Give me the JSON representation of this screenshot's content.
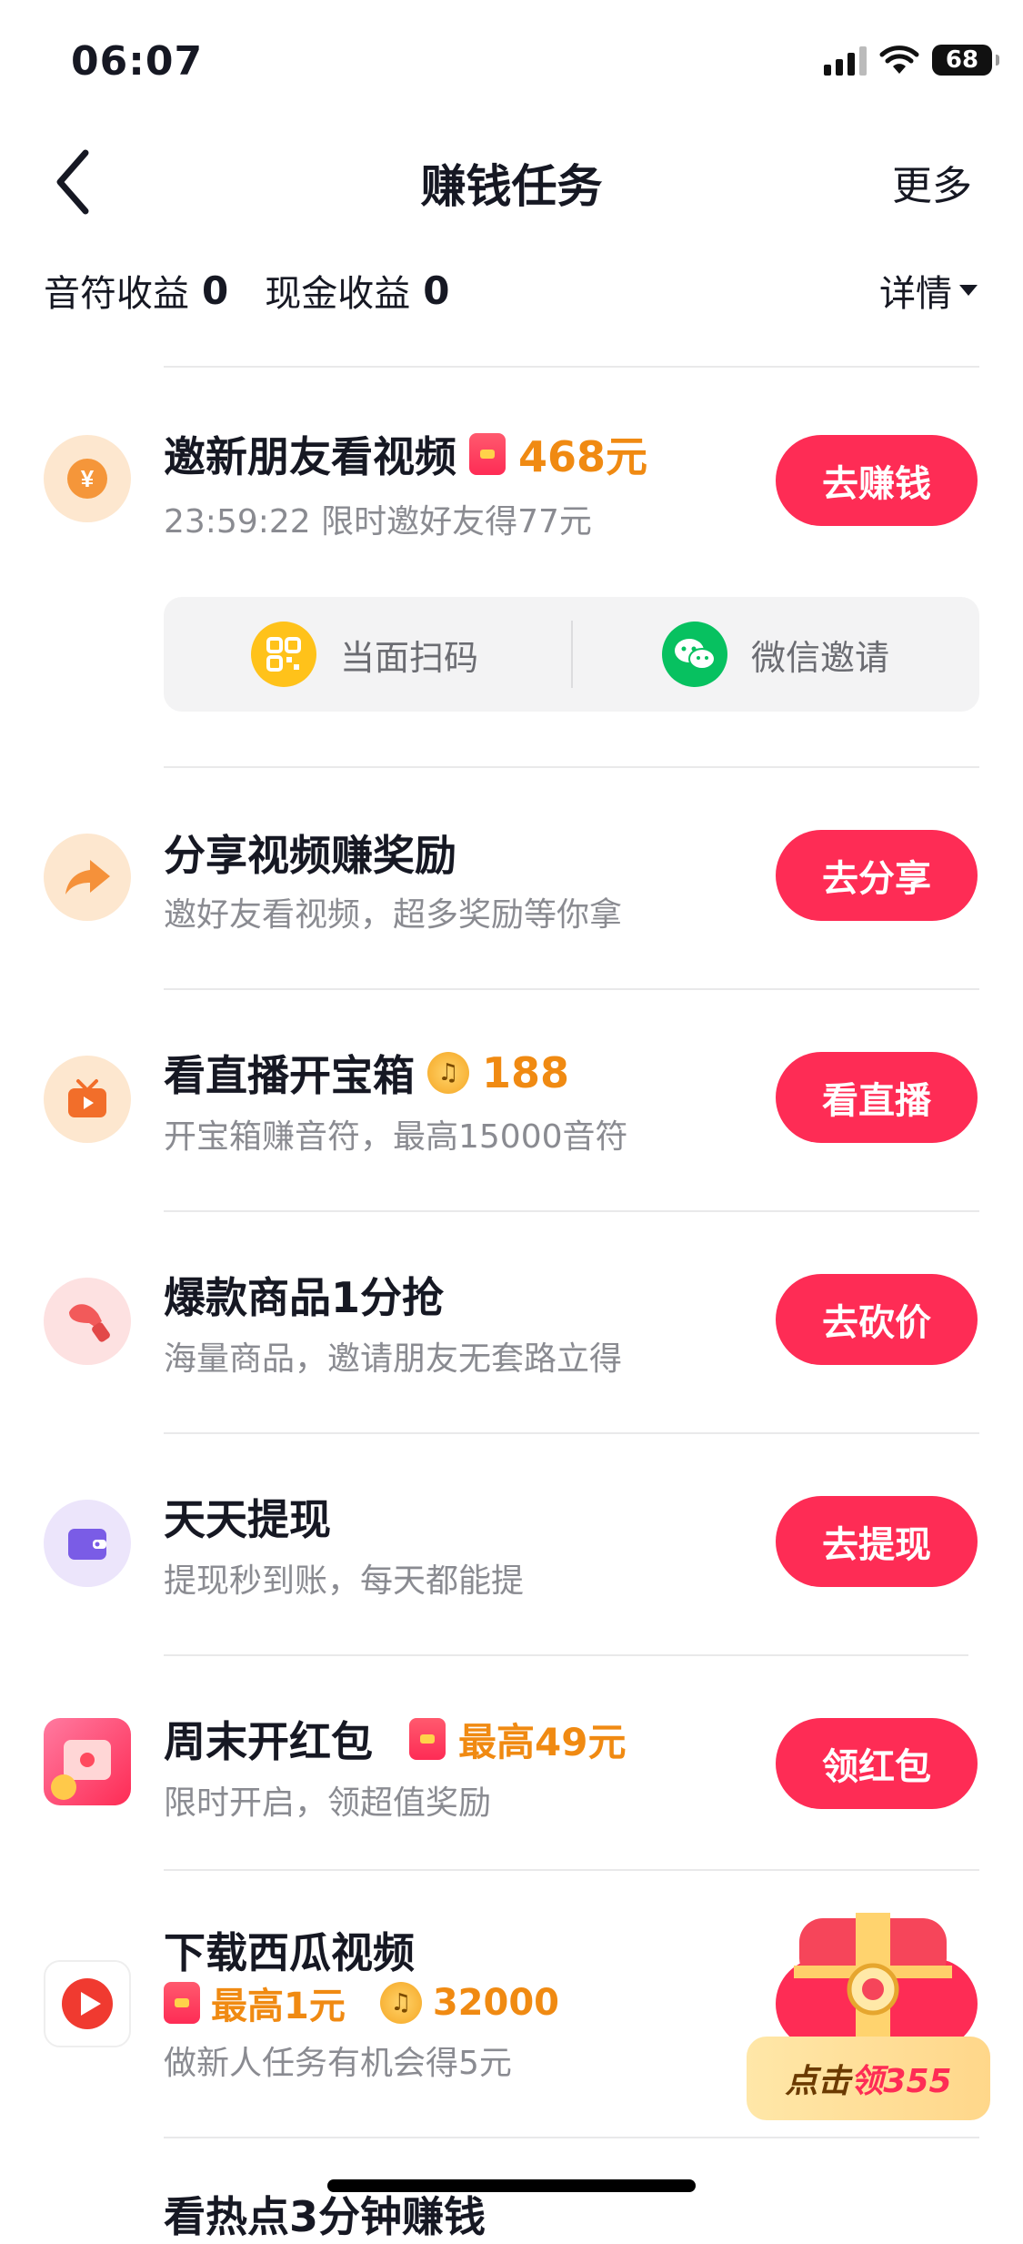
{
  "status_bar": {
    "time": "06:07",
    "battery": "68"
  },
  "nav": {
    "title": "赚钱任务",
    "more": "更多"
  },
  "earnings": {
    "note_label": "音符收益",
    "note_value": "0",
    "cash_label": "现金收益",
    "cash_value": "0",
    "detail": "详情"
  },
  "tasks": [
    {
      "title": "邀新朋友看视频",
      "reward": "468元",
      "subtitle": "23:59:22 限时邀好友得77元",
      "button": "去赚钱"
    },
    {
      "title": "分享视频赚奖励",
      "subtitle": "邀好友看视频，超多奖励等你拿",
      "button": "去分享"
    },
    {
      "title": "看直播开宝箱",
      "reward": "188",
      "subtitle": "开宝箱赚音符，最高15000音符",
      "button": "看直播"
    },
    {
      "title": "爆款商品1分抢",
      "subtitle": "海量商品，邀请朋友无套路立得",
      "button": "去砍价"
    },
    {
      "title": "天天提现",
      "subtitle": "提现秒到账，每天都能提",
      "button": "去提现"
    },
    {
      "title": "周末开红包",
      "reward": "最高49元",
      "subtitle": "限时开启，领超值奖励",
      "button": "领红包"
    },
    {
      "title": "下载西瓜视频",
      "reward_cash": "最高1元",
      "reward_notes": "32000",
      "subtitle": "做新人任务有机会得5元"
    },
    {
      "title": "看热点3分钟赚钱"
    }
  ],
  "invite_panel": {
    "scan": "当面扫码",
    "wechat": "微信邀请"
  },
  "floating": {
    "prefix": "点击",
    "action": "领355"
  },
  "colors": {
    "primary": "#fe2c55",
    "reward": "#f08a12"
  }
}
